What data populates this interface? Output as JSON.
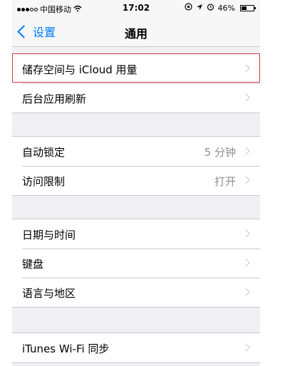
{
  "status_bar": {
    "carrier": "中国移动",
    "time": "17:02",
    "battery": "46%",
    "battery_level": 0.46
  },
  "nav": {
    "back_label": "设置",
    "title": "通用"
  },
  "groups": [
    {
      "rows": [
        {
          "label": "储存空间与 iCloud 用量",
          "value": ""
        },
        {
          "label": "后台应用刷新",
          "value": ""
        }
      ]
    },
    {
      "rows": [
        {
          "label": "自动锁定",
          "value": "5 分钟"
        },
        {
          "label": "访问限制",
          "value": "打开"
        }
      ]
    },
    {
      "rows": [
        {
          "label": "日期与时间",
          "value": ""
        },
        {
          "label": "键盘",
          "value": ""
        },
        {
          "label": "语言与地区",
          "value": ""
        }
      ]
    },
    {
      "rows": [
        {
          "label": "iTunes Wi-Fi 同步",
          "value": ""
        }
      ]
    }
  ],
  "colors": {
    "accent": "#007aff",
    "highlight_border": "#d9383a",
    "background": "#efeff4"
  }
}
